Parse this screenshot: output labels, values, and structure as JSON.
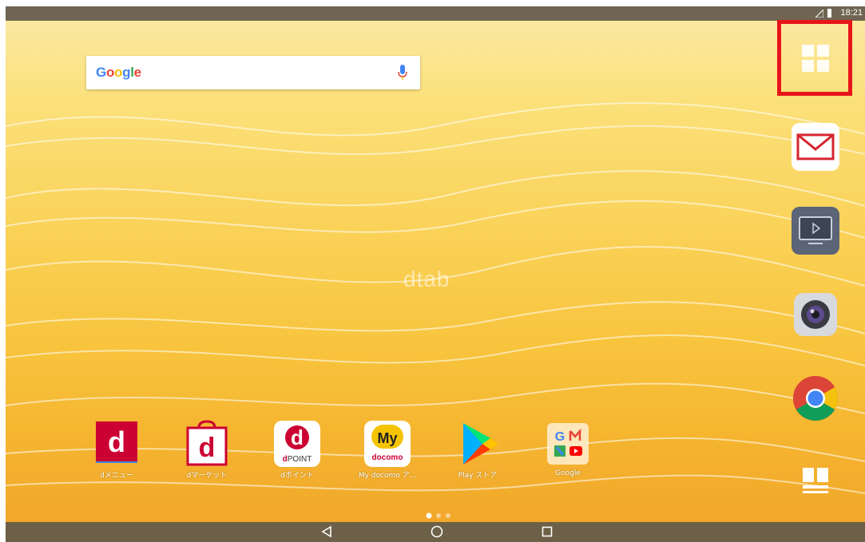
{
  "status_bar": {
    "time": "18:21"
  },
  "search": {
    "logo_letters": [
      "G",
      "o",
      "o",
      "g",
      "l",
      "e"
    ],
    "logo_colors": [
      "#4285f4",
      "#ea4335",
      "#fbbc05",
      "#4285f4",
      "#34a853",
      "#ea4335"
    ]
  },
  "wallpaper": {
    "brand_text": "dtab"
  },
  "dock": [
    {
      "name": "apps-drawer-icon",
      "highlighted": true
    },
    {
      "name": "mail-icon"
    },
    {
      "name": "tv-icon"
    },
    {
      "name": "camera-icon"
    },
    {
      "name": "chrome-icon"
    },
    {
      "name": "widget-icon"
    }
  ],
  "home_apps": [
    {
      "label": "dメニュー",
      "icon": "d-menu-icon"
    },
    {
      "label": "dマーケット",
      "icon": "d-market-icon"
    },
    {
      "label": "dポイント",
      "icon": "d-point-icon",
      "sub": "POINT"
    },
    {
      "label": "My docomo ア...",
      "icon": "my-docomo-icon",
      "top": "My",
      "sub": "docomo"
    },
    {
      "label": "Play ストア",
      "icon": "play-store-icon"
    },
    {
      "label": "Google",
      "icon": "google-folder-icon"
    }
  ],
  "highlight_color": "#e8141a",
  "pages": {
    "count": 3,
    "active": 1
  }
}
